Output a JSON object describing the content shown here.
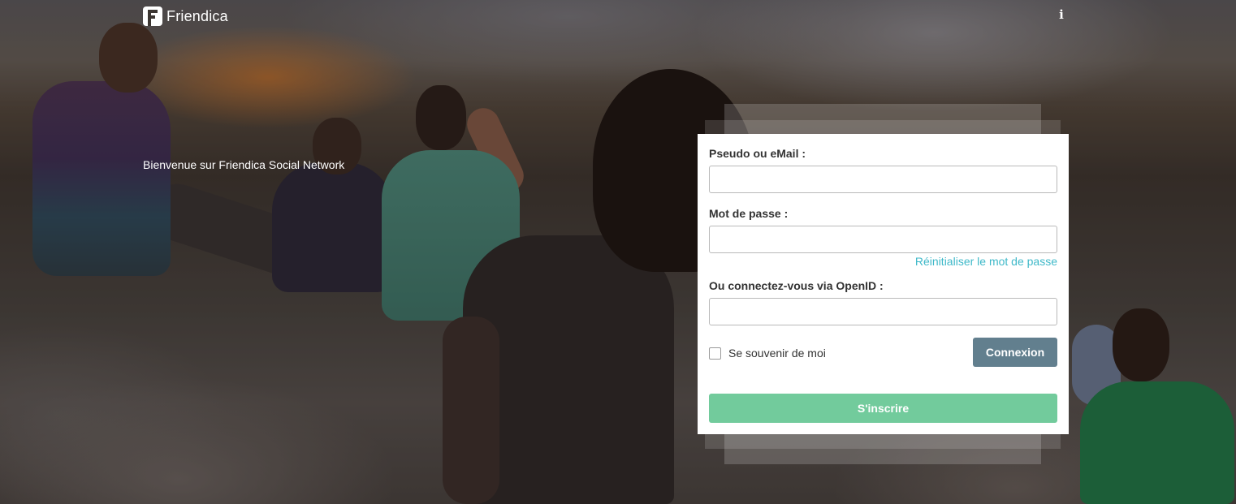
{
  "brand": {
    "name": "Friendica",
    "logo_icon": "friendica-logo-icon"
  },
  "topbar": {
    "info_icon": "info-icon",
    "info_glyph": "i"
  },
  "welcome_text": "Bienvenue sur Friendica Social Network",
  "login_form": {
    "username_label": "Pseudo ou eMail :",
    "username_value": "",
    "password_label": "Mot de passe :",
    "password_value": "",
    "reset_password_link": "Réinitialiser le mot de passe",
    "openid_label": "Ou connectez-vous via OpenID :",
    "openid_value": "",
    "remember_me_label": "Se souvenir de moi",
    "remember_me_checked": false,
    "login_button": "Connexion",
    "register_button": "S'inscrire"
  },
  "colors": {
    "login_button": "#627f8e",
    "register_button": "#72cb9c",
    "link": "#3fb9c9"
  }
}
